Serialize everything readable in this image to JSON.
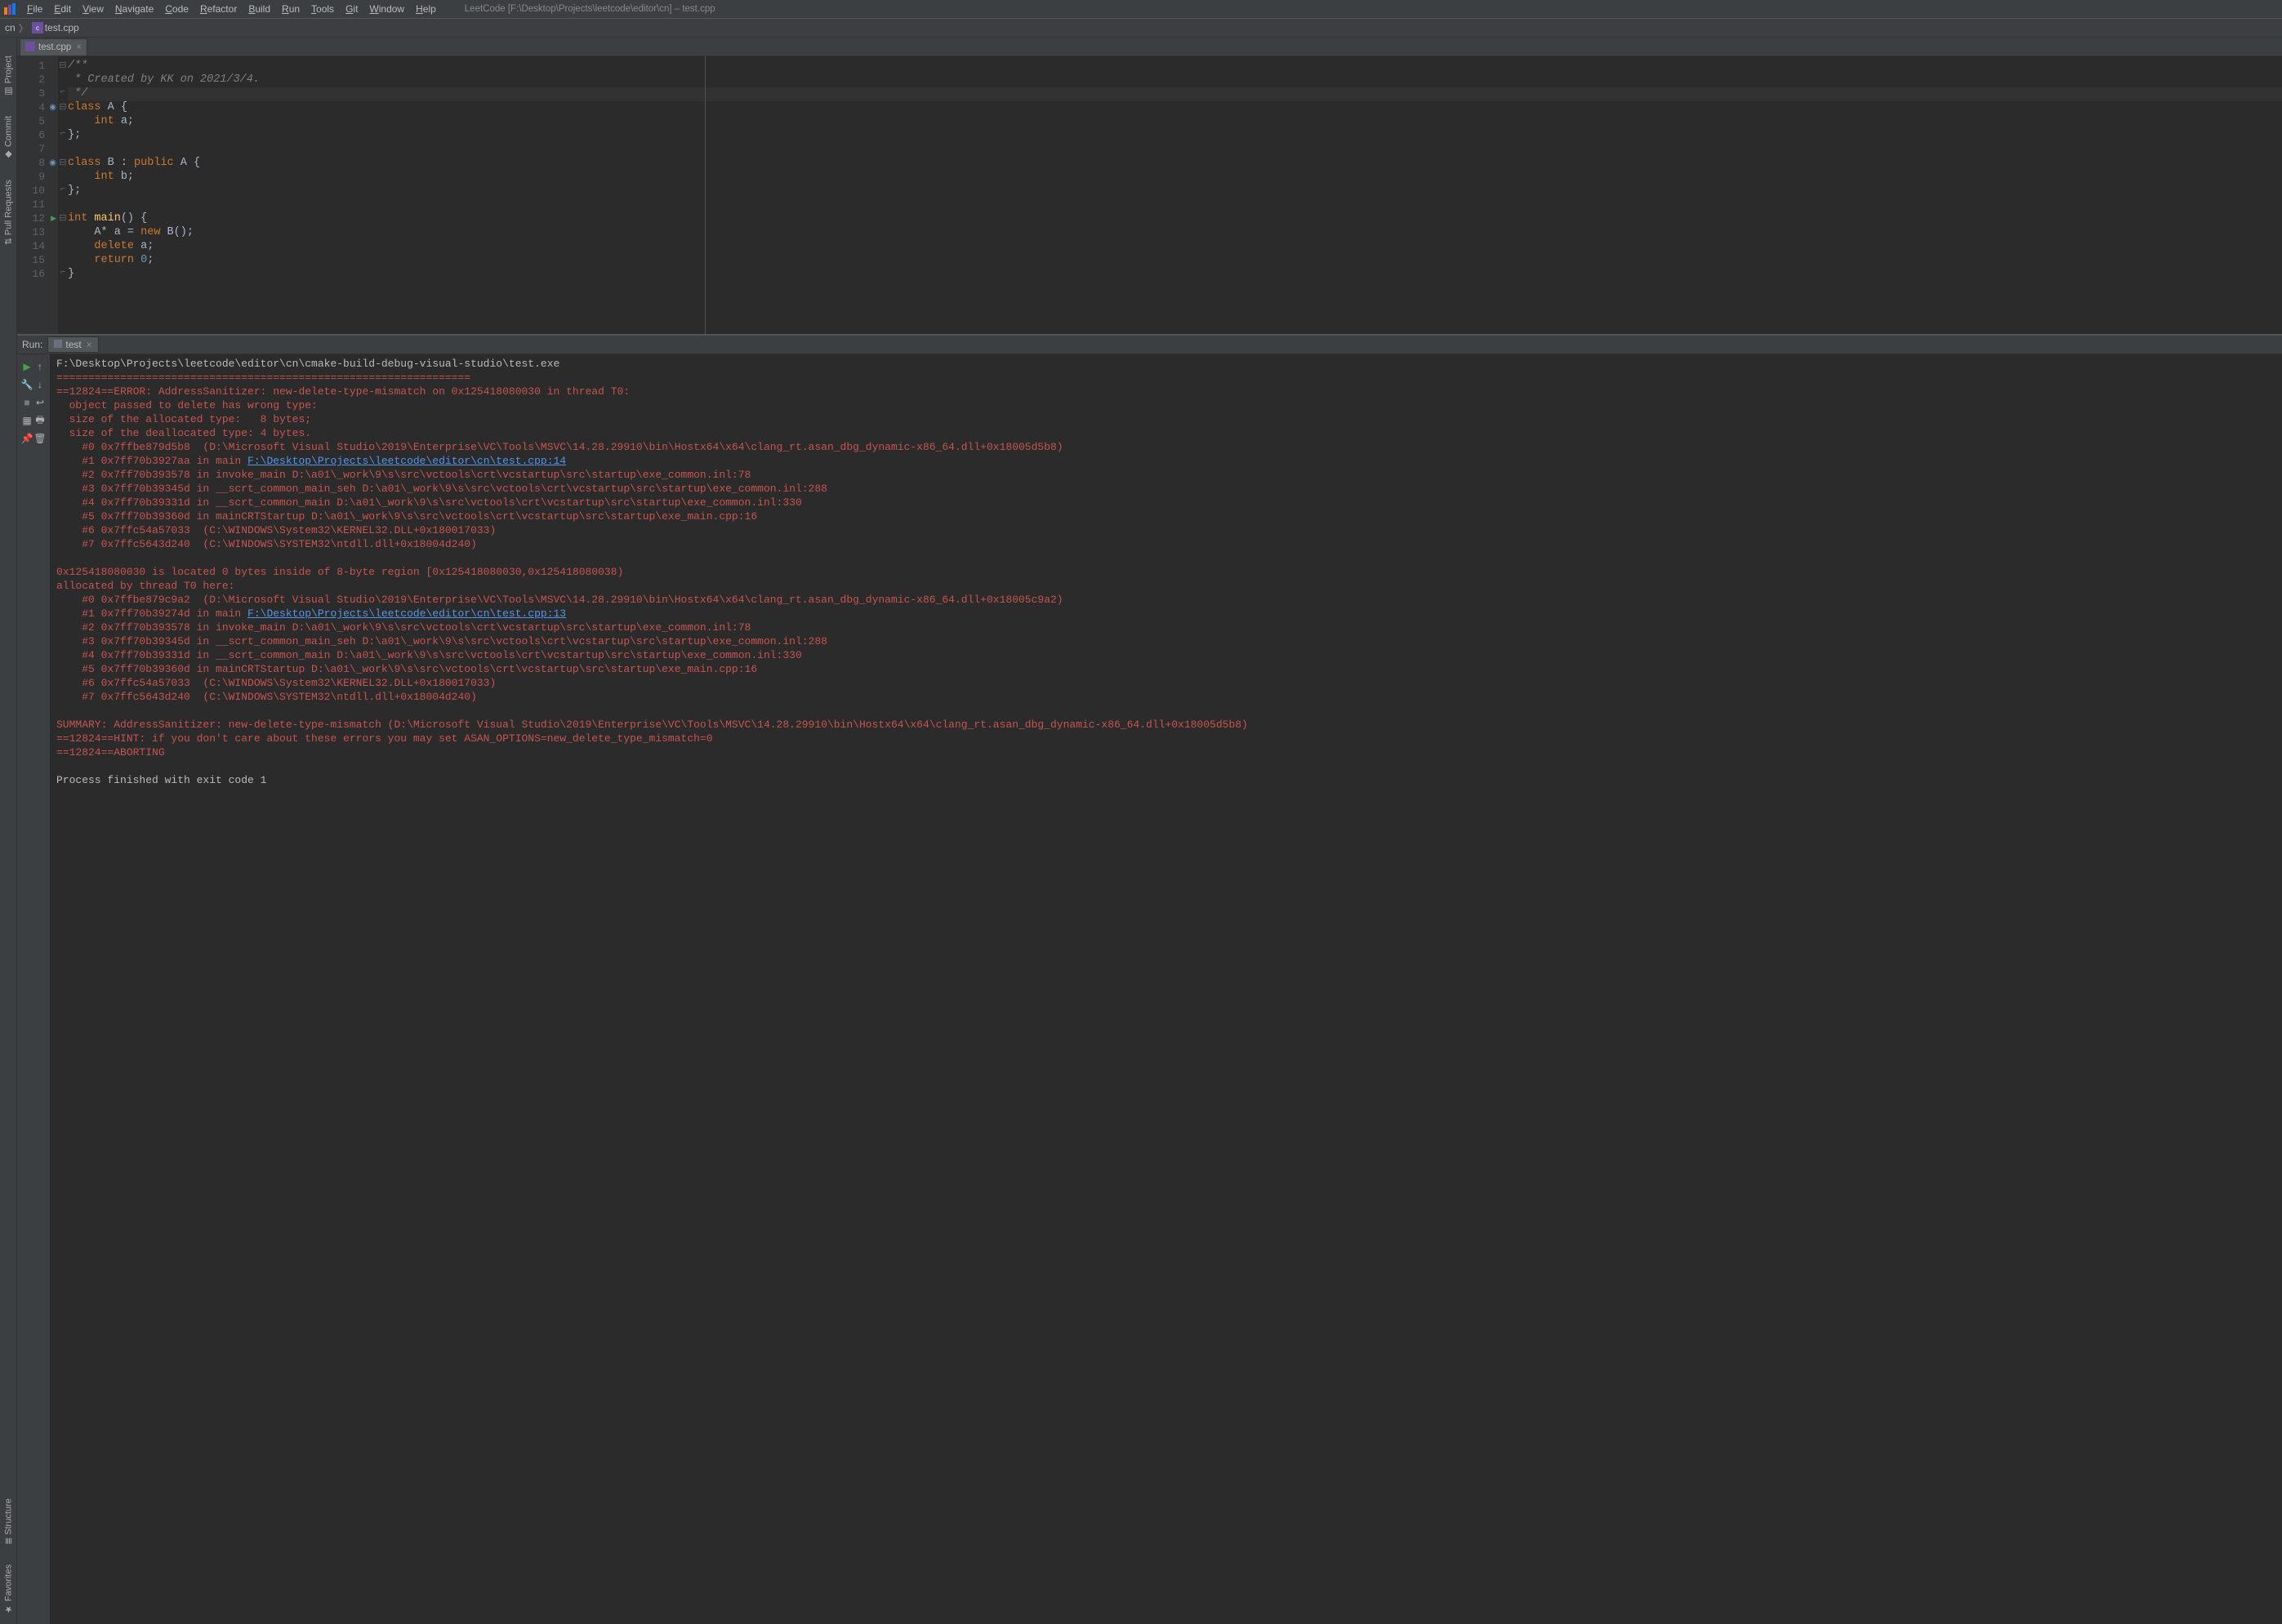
{
  "menubar": {
    "items": [
      "File",
      "Edit",
      "View",
      "Navigate",
      "Code",
      "Refactor",
      "Build",
      "Run",
      "Tools",
      "Git",
      "Window",
      "Help"
    ],
    "title": "LeetCode [F:\\Desktop\\Projects\\leetcode\\editor\\cn] – test.cpp"
  },
  "breadcrumb": {
    "root": "cn",
    "file": "test.cpp"
  },
  "sidebar": {
    "items": [
      "Project",
      "Commit",
      "Pull Requests",
      "Structure",
      "Favorites"
    ]
  },
  "editor": {
    "tab_file": "test.cpp",
    "lines": [
      {
        "n": "1",
        "tokens": [
          {
            "t": "/**",
            "c": "comment"
          }
        ]
      },
      {
        "n": "2",
        "tokens": [
          {
            "t": " * Created by KK on 2021/3/4.",
            "c": "comment"
          }
        ]
      },
      {
        "n": "3",
        "hl": true,
        "tokens": [
          {
            "t": " */",
            "c": "comment"
          }
        ]
      },
      {
        "n": "4",
        "icon": "inh",
        "tokens": [
          {
            "t": "class ",
            "c": "keyword"
          },
          {
            "t": "A ",
            "c": "type"
          },
          {
            "t": "{",
            "c": "punct"
          }
        ]
      },
      {
        "n": "5",
        "tokens": [
          {
            "t": "    ",
            "c": "plain"
          },
          {
            "t": "int ",
            "c": "keyword"
          },
          {
            "t": "a",
            "c": "ident"
          },
          {
            "t": ";",
            "c": "punct"
          }
        ]
      },
      {
        "n": "6",
        "tokens": [
          {
            "t": "};",
            "c": "punct"
          }
        ]
      },
      {
        "n": "7",
        "tokens": []
      },
      {
        "n": "8",
        "icon": "inh",
        "tokens": [
          {
            "t": "class ",
            "c": "keyword"
          },
          {
            "t": "B ",
            "c": "type"
          },
          {
            "t": ": ",
            "c": "punct"
          },
          {
            "t": "public ",
            "c": "keyword"
          },
          {
            "t": "A ",
            "c": "type"
          },
          {
            "t": "{",
            "c": "punct"
          }
        ]
      },
      {
        "n": "9",
        "tokens": [
          {
            "t": "    ",
            "c": "plain"
          },
          {
            "t": "int ",
            "c": "keyword"
          },
          {
            "t": "b",
            "c": "ident"
          },
          {
            "t": ";",
            "c": "punct"
          }
        ]
      },
      {
        "n": "10",
        "tokens": [
          {
            "t": "};",
            "c": "punct"
          }
        ]
      },
      {
        "n": "11",
        "tokens": []
      },
      {
        "n": "12",
        "icon": "run",
        "tokens": [
          {
            "t": "int ",
            "c": "keyword"
          },
          {
            "t": "main",
            "c": "func"
          },
          {
            "t": "() {",
            "c": "punct"
          }
        ]
      },
      {
        "n": "13",
        "tokens": [
          {
            "t": "    ",
            "c": "plain"
          },
          {
            "t": "A* ",
            "c": "type"
          },
          {
            "t": "a ",
            "c": "ident"
          },
          {
            "t": "= ",
            "c": "op"
          },
          {
            "t": "new ",
            "c": "keyword"
          },
          {
            "t": "B",
            "c": "class"
          },
          {
            "t": "();",
            "c": "punct"
          }
        ]
      },
      {
        "n": "14",
        "tokens": [
          {
            "t": "    ",
            "c": "plain"
          },
          {
            "t": "delete ",
            "c": "keyword"
          },
          {
            "t": "a",
            "c": "ident"
          },
          {
            "t": ";",
            "c": "punct"
          }
        ]
      },
      {
        "n": "15",
        "tokens": [
          {
            "t": "    ",
            "c": "plain"
          },
          {
            "t": "return ",
            "c": "keyword"
          },
          {
            "t": "0",
            "c": "num"
          },
          {
            "t": ";",
            "c": "punct"
          }
        ]
      },
      {
        "n": "16",
        "tokens": [
          {
            "t": "}",
            "c": "punct"
          }
        ]
      }
    ]
  },
  "run": {
    "label": "Run:",
    "tab": "test",
    "exe_path": "F:\\Desktop\\Projects\\leetcode\\editor\\cn\\cmake-build-debug-visual-studio\\test.exe",
    "output": [
      {
        "c": "red",
        "t": "================================================================="
      },
      {
        "c": "red",
        "t": "==12824==ERROR: AddressSanitizer: new-delete-type-mismatch on 0x125418080030 in thread T0:"
      },
      {
        "c": "red",
        "t": "  object passed to delete has wrong type:"
      },
      {
        "c": "red",
        "t": "  size of the allocated type:   8 bytes;"
      },
      {
        "c": "red",
        "t": "  size of the deallocated type: 4 bytes."
      },
      {
        "c": "red",
        "t": "    #0 0x7ffbe879d5b8  (D:\\Microsoft Visual Studio\\2019\\Enterprise\\VC\\Tools\\MSVC\\14.28.29910\\bin\\Hostx64\\x64\\clang_rt.asan_dbg_dynamic-x86_64.dll+0x18005d5b8)"
      },
      {
        "segments": [
          {
            "c": "red",
            "t": "    #1 0x7ff70b3927aa in main "
          },
          {
            "c": "link",
            "t": "F:\\Desktop\\Projects\\leetcode\\editor\\cn\\test.cpp:14"
          }
        ]
      },
      {
        "c": "red",
        "t": "    #2 0x7ff70b393578 in invoke_main D:\\a01\\_work\\9\\s\\src\\vctools\\crt\\vcstartup\\src\\startup\\exe_common.inl:78"
      },
      {
        "c": "red",
        "t": "    #3 0x7ff70b39345d in __scrt_common_main_seh D:\\a01\\_work\\9\\s\\src\\vctools\\crt\\vcstartup\\src\\startup\\exe_common.inl:288"
      },
      {
        "c": "red",
        "t": "    #4 0x7ff70b39331d in __scrt_common_main D:\\a01\\_work\\9\\s\\src\\vctools\\crt\\vcstartup\\src\\startup\\exe_common.inl:330"
      },
      {
        "c": "red",
        "t": "    #5 0x7ff70b39360d in mainCRTStartup D:\\a01\\_work\\9\\s\\src\\vctools\\crt\\vcstartup\\src\\startup\\exe_main.cpp:16"
      },
      {
        "c": "red",
        "t": "    #6 0x7ffc54a57033  (C:\\WINDOWS\\System32\\KERNEL32.DLL+0x180017033)"
      },
      {
        "c": "red",
        "t": "    #7 0x7ffc5643d240  (C:\\WINDOWS\\SYSTEM32\\ntdll.dll+0x18004d240)"
      },
      {
        "c": "red",
        "t": ""
      },
      {
        "c": "red",
        "t": "0x125418080030 is located 0 bytes inside of 8-byte region [0x125418080030,0x125418080038)"
      },
      {
        "c": "red",
        "t": "allocated by thread T0 here:"
      },
      {
        "c": "red",
        "t": "    #0 0x7ffbe879c9a2  (D:\\Microsoft Visual Studio\\2019\\Enterprise\\VC\\Tools\\MSVC\\14.28.29910\\bin\\Hostx64\\x64\\clang_rt.asan_dbg_dynamic-x86_64.dll+0x18005c9a2)"
      },
      {
        "segments": [
          {
            "c": "red",
            "t": "    #1 0x7ff70b39274d in main "
          },
          {
            "c": "link",
            "t": "F:\\Desktop\\Projects\\leetcode\\editor\\cn\\test.cpp:13"
          }
        ]
      },
      {
        "c": "red",
        "t": "    #2 0x7ff70b393578 in invoke_main D:\\a01\\_work\\9\\s\\src\\vctools\\crt\\vcstartup\\src\\startup\\exe_common.inl:78"
      },
      {
        "c": "red",
        "t": "    #3 0x7ff70b39345d in __scrt_common_main_seh D:\\a01\\_work\\9\\s\\src\\vctools\\crt\\vcstartup\\src\\startup\\exe_common.inl:288"
      },
      {
        "c": "red",
        "t": "    #4 0x7ff70b39331d in __scrt_common_main D:\\a01\\_work\\9\\s\\src\\vctools\\crt\\vcstartup\\src\\startup\\exe_common.inl:330"
      },
      {
        "c": "red",
        "t": "    #5 0x7ff70b39360d in mainCRTStartup D:\\a01\\_work\\9\\s\\src\\vctools\\crt\\vcstartup\\src\\startup\\exe_main.cpp:16"
      },
      {
        "c": "red",
        "t": "    #6 0x7ffc54a57033  (C:\\WINDOWS\\System32\\KERNEL32.DLL+0x180017033)"
      },
      {
        "c": "red",
        "t": "    #7 0x7ffc5643d240  (C:\\WINDOWS\\SYSTEM32\\ntdll.dll+0x18004d240)"
      },
      {
        "c": "red",
        "t": ""
      },
      {
        "c": "red",
        "t": "SUMMARY: AddressSanitizer: new-delete-type-mismatch (D:\\Microsoft Visual Studio\\2019\\Enterprise\\VC\\Tools\\MSVC\\14.28.29910\\bin\\Hostx64\\x64\\clang_rt.asan_dbg_dynamic-x86_64.dll+0x18005d5b8) "
      },
      {
        "c": "red",
        "t": "==12824==HINT: if you don't care about these errors you may set ASAN_OPTIONS=new_delete_type_mismatch=0"
      },
      {
        "c": "red",
        "t": "==12824==ABORTING"
      },
      {
        "c": "plain",
        "t": ""
      },
      {
        "c": "plain",
        "t": "Process finished with exit code 1"
      }
    ]
  }
}
